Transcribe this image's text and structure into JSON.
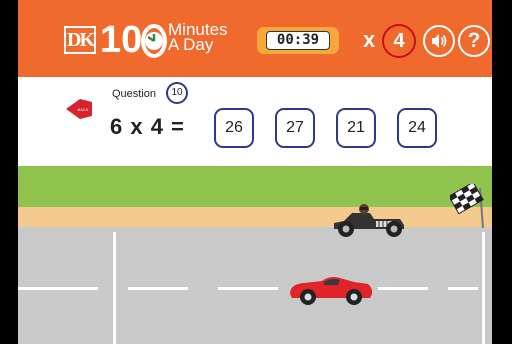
{
  "header": {
    "logo_text": "DK",
    "brand_number": "10",
    "brand_line1": "Minutes",
    "brand_line2": "A Day",
    "timer": "00:39",
    "multiplier_symbol": "x",
    "multiplier_value": "4",
    "help_label": "?"
  },
  "question": {
    "label": "Question",
    "number": "10",
    "back_label": "BACK",
    "equation": "6 x 4 =",
    "answers": [
      "26",
      "27",
      "21",
      "24"
    ]
  },
  "colors": {
    "header_bg": "#ef6a2c",
    "timer_bg": "#f6a93b",
    "accent_red": "#c8101a",
    "answer_border": "#2d3a8c",
    "grass": "#8fc34d",
    "verge": "#f4c98e",
    "road": "#c9c9c9",
    "player_car": "#e0242a",
    "opponent_car": "#333333"
  },
  "icons": {
    "back": "back-arrow-icon",
    "sound": "speaker-icon",
    "help": "question-mark-icon",
    "clock": "clock-icon",
    "finish": "checkered-flag-icon"
  }
}
